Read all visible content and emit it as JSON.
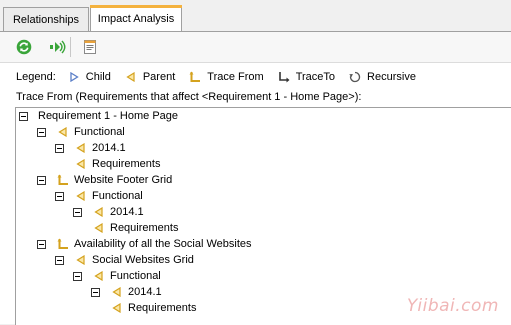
{
  "tabs": [
    {
      "label": "Relationships",
      "active": false
    },
    {
      "label": "Impact Analysis",
      "active": true
    }
  ],
  "toolbar": {
    "buttons": [
      {
        "icon": "refresh-icon"
      },
      {
        "icon": "trace-icon"
      },
      {
        "icon": "report-icon"
      }
    ]
  },
  "legend": {
    "title": "Legend:",
    "items": [
      {
        "icon": "child-icon",
        "label": "Child"
      },
      {
        "icon": "parent-icon",
        "label": "Parent"
      },
      {
        "icon": "trace-from-icon",
        "label": "Trace From"
      },
      {
        "icon": "trace-to-icon",
        "label": "TraceTo"
      },
      {
        "icon": "recursive-icon",
        "label": "Recursive"
      }
    ]
  },
  "trace_header": "Trace From (Requirements that affect <Requirement 1 - Home Page>):",
  "tree": [
    {
      "level": 0,
      "toggle": true,
      "icon": "none",
      "label": "Requirement 1 - Home Page"
    },
    {
      "level": 1,
      "toggle": true,
      "icon": "parent",
      "label": "Functional"
    },
    {
      "level": 2,
      "toggle": true,
      "icon": "parent",
      "label": "2014.1"
    },
    {
      "level": 3,
      "toggle": false,
      "icon": "parent",
      "label": "Requirements"
    },
    {
      "level": 1,
      "toggle": true,
      "icon": "trace-from",
      "label": "Website Footer Grid"
    },
    {
      "level": 2,
      "toggle": true,
      "icon": "parent",
      "label": "Functional"
    },
    {
      "level": 3,
      "toggle": true,
      "icon": "parent",
      "label": "2014.1"
    },
    {
      "level": 4,
      "toggle": false,
      "icon": "parent",
      "label": "Requirements"
    },
    {
      "level": 1,
      "toggle": true,
      "icon": "trace-from",
      "label": "Availability of all the Social Websites"
    },
    {
      "level": 2,
      "toggle": true,
      "icon": "parent",
      "label": "Social Websites Grid"
    },
    {
      "level": 3,
      "toggle": true,
      "icon": "parent",
      "label": "Functional"
    },
    {
      "level": 4,
      "toggle": true,
      "icon": "parent",
      "label": "2014.1"
    },
    {
      "level": 5,
      "toggle": false,
      "icon": "parent",
      "label": "Requirements"
    }
  ],
  "watermark": "Yiibai.com",
  "colors": {
    "tab_accent": "#f4b23e",
    "parent_icon": "#e8b73a",
    "child_icon": "#5b7fc8"
  }
}
